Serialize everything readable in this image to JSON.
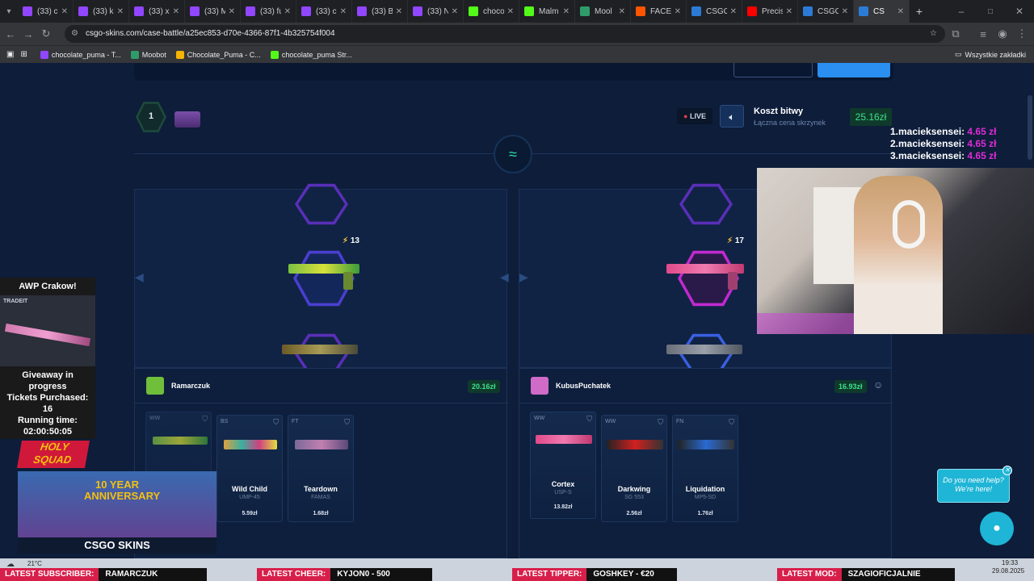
{
  "browser": {
    "tabs": [
      {
        "label": "(33) c",
        "color": "#9146ff"
      },
      {
        "label": "(33) k",
        "color": "#9146ff"
      },
      {
        "label": "(33) xl",
        "color": "#9146ff"
      },
      {
        "label": "(33) M",
        "color": "#9146ff"
      },
      {
        "label": "(33) fu",
        "color": "#9146ff"
      },
      {
        "label": "(33) cl",
        "color": "#9146ff"
      },
      {
        "label": "(33) B",
        "color": "#9146ff"
      },
      {
        "label": "(33) N",
        "color": "#9146ff"
      },
      {
        "label": "choco",
        "color": "#53fc18"
      },
      {
        "label": "Malm",
        "color": "#53fc18"
      },
      {
        "label": "Mool",
        "color": "#2e9c6a"
      },
      {
        "label": "FACEI",
        "color": "#ff5500"
      },
      {
        "label": "CSGO",
        "color": "#2b7bd6"
      },
      {
        "label": "Precis",
        "color": "#ff0000"
      },
      {
        "label": "CSGO",
        "color": "#2b7bd6"
      },
      {
        "label": "CS",
        "color": "#2b7bd6"
      }
    ],
    "url": "csgo-skins.com/case-battle/a25ec853-d70e-4366-87f1-4b325754f004",
    "bookmarks": [
      {
        "label": "chocolate_puma - T...",
        "color": "#9146ff"
      },
      {
        "label": "Moobot",
        "color": "#2e9c6a"
      },
      {
        "label": "Chocolate_Puma - C...",
        "color": "#f4b400"
      },
      {
        "label": "chocolate_puma Str...",
        "color": "#53fc18"
      }
    ],
    "all_bookmarks": "Wszystkie zakładki"
  },
  "battle": {
    "round": "1",
    "live": "LIVE",
    "cost_title": "Koszt bitwy",
    "cost_sub": "Łączna cena skrzynek",
    "cost_value": "25.16zł",
    "left_spin_count": "13",
    "right_spin_count": "17"
  },
  "players": [
    {
      "name": "Ramarczuk",
      "total": "20.16zł",
      "items": [
        {
          "cond": "WW",
          "name": "",
          "skin": "",
          "price": ""
        },
        {
          "cond": "BS",
          "name": "Wild Child",
          "skin": "UMP-45",
          "price": "5.59zł"
        },
        {
          "cond": "FT",
          "name": "Teardown",
          "skin": "FAMAS",
          "price": "1.68zł"
        }
      ]
    },
    {
      "name": "KubusPuchatek",
      "total": "16.93zł",
      "items": [
        {
          "cond": "WW",
          "name": "Cortex",
          "skin": "USP-S",
          "price": "13.82zł"
        },
        {
          "cond": "WW",
          "name": "Darkwing",
          "skin": "SG 553",
          "price": "2.56zł"
        },
        {
          "cond": "FN",
          "name": "Liquidation",
          "skin": "MP5-SD",
          "price": "1.76zł"
        }
      ]
    }
  ],
  "leaderboard": [
    {
      "rank": "1.",
      "name": "macieksensei:",
      "amount": "4.65 zł"
    },
    {
      "rank": "2.",
      "name": "macieksensei:",
      "amount": "4.65 zł"
    },
    {
      "rank": "3.",
      "name": "macieksensei:",
      "amount": "4.65 zł"
    }
  ],
  "giveaway": {
    "title": "AWP Crakow!",
    "brand": "TRADEIT",
    "line1": "Giveaway in",
    "line2": "progress",
    "line3": "Tickets Purchased:",
    "line4": "16",
    "line5": "Running time:",
    "line6": "02:00:50:05"
  },
  "stream": {
    "holy_squad": "HOLY SQUAD",
    "anniversary": "10 YEAR ANNIVERSARY",
    "csgo_skins": "CSGO SKINS",
    "help": "Do you need help? We're here!"
  },
  "taskbar": {
    "temp": "21°C",
    "time": "19:33",
    "date": "29.08.2025"
  },
  "tickers": [
    {
      "label": "LATEST SUBSCRIBER:",
      "value": "RAMARCZUK"
    },
    {
      "label": "LATEST CHEER:",
      "value": "KYJON0 - 500"
    },
    {
      "label": "LATEST TIPPER:",
      "value": "GOSHKEY - €20"
    },
    {
      "label": "LATEST MOD:",
      "value": "SZAGIOFICJALNIE"
    }
  ]
}
